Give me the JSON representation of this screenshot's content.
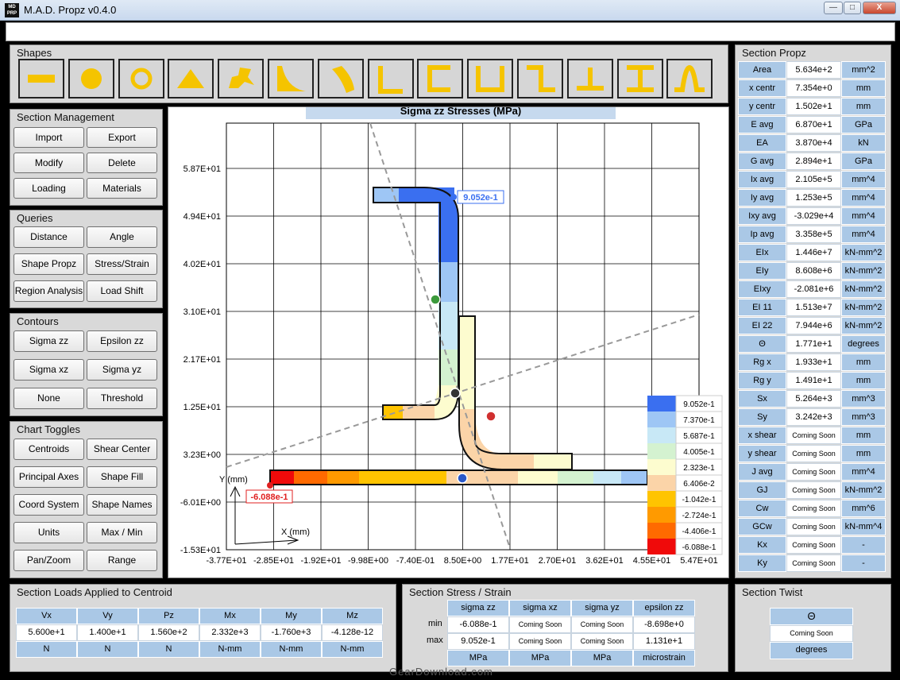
{
  "window": {
    "title": "M.A.D. Propz v0.4.0",
    "icon_text": "MD PRP",
    "minimize": "—",
    "maximize": "□",
    "close": "X"
  },
  "shapes": {
    "title": "Shapes",
    "items": [
      "rectangle-shape",
      "circle-shape",
      "ring-shape",
      "triangle-shape",
      "custom-shape",
      "spandrel-shape",
      "curved-shape",
      "angle-shape",
      "channel-shape",
      "u-shape",
      "z-shape",
      "tee-shape",
      "i-beam-shape",
      "hat-shape"
    ]
  },
  "section_management": {
    "title": "Section Management",
    "buttons": [
      "Import",
      "Export",
      "Modify",
      "Delete",
      "Loading",
      "Materials"
    ]
  },
  "queries": {
    "title": "Queries",
    "buttons": [
      "Distance",
      "Angle",
      "Shape Propz",
      "Stress/Strain",
      "Region Analysis",
      "Load Shift"
    ]
  },
  "contours": {
    "title": "Contours",
    "buttons": [
      "Sigma zz",
      "Epsilon zz",
      "Sigma xz",
      "Sigma yz",
      "None",
      "Threshold"
    ]
  },
  "chart_toggles": {
    "title": "Chart Toggles",
    "buttons": [
      "Centroids",
      "Shear Center",
      "Principal Axes",
      "Shape Fill",
      "Coord System",
      "Shape Names",
      "Units",
      "Max / Min",
      "Pan/Zoom",
      "Range"
    ]
  },
  "chart": {
    "title": "Sigma zz Stresses (MPa)",
    "y_ticks": [
      "5.87E+01",
      "4.94E+01",
      "4.02E+01",
      "3.10E+01",
      "2.17E+01",
      "1.25E+01",
      "3.23E+00",
      "-6.01E+00",
      "-1.53E+01"
    ],
    "x_ticks": [
      "-3.77E+01",
      "-2.85E+01",
      "-1.92E+01",
      "-9.98E+00",
      "-7.40E-01",
      "8.50E+00",
      "1.77E+01",
      "2.70E+01",
      "3.62E+01",
      "4.55E+01",
      "5.47E+01"
    ],
    "max_label": "9.052e-1",
    "min_label": "-6.088e-1",
    "axis_y_label": "Y (mm)",
    "axis_x_label": "X (mm)",
    "legend": [
      {
        "value": "9.052e-1",
        "color": "#3a6ff0"
      },
      {
        "value": "7.370e-1",
        "color": "#9ec6f5"
      },
      {
        "value": "5.687e-1",
        "color": "#c8e8f6"
      },
      {
        "value": "4.005e-1",
        "color": "#d4f2d0"
      },
      {
        "value": "2.323e-1",
        "color": "#fdfccf"
      },
      {
        "value": "6.406e-2",
        "color": "#fbd4a8"
      },
      {
        "value": "-1.042e-1",
        "color": "#ffc400"
      },
      {
        "value": "-2.724e-1",
        "color": "#ff9a00"
      },
      {
        "value": "-4.406e-1",
        "color": "#ff6a00"
      },
      {
        "value": "-6.088e-1",
        "color": "#f00a0a"
      }
    ]
  },
  "section_propz": {
    "title": "Section Propz",
    "rows": [
      [
        "Area",
        "5.634e+2",
        "mm^2"
      ],
      [
        "x centr",
        "7.354e+0",
        "mm"
      ],
      [
        "y centr",
        "1.502e+1",
        "mm"
      ],
      [
        "E avg",
        "6.870e+1",
        "GPa"
      ],
      [
        "EA",
        "3.870e+4",
        "kN"
      ],
      [
        "G avg",
        "2.894e+1",
        "GPa"
      ],
      [
        "Ix avg",
        "2.105e+5",
        "mm^4"
      ],
      [
        "Iy avg",
        "1.253e+5",
        "mm^4"
      ],
      [
        "Ixy avg",
        "-3.029e+4",
        "mm^4"
      ],
      [
        "Ip avg",
        "3.358e+5",
        "mm^4"
      ],
      [
        "EIx",
        "1.446e+7",
        "kN-mm^2"
      ],
      [
        "EIy",
        "8.608e+6",
        "kN-mm^2"
      ],
      [
        "EIxy",
        "-2.081e+6",
        "kN-mm^2"
      ],
      [
        "EI 11",
        "1.513e+7",
        "kN-mm^2"
      ],
      [
        "EI 22",
        "7.944e+6",
        "kN-mm^2"
      ],
      [
        "Θ",
        "1.771e+1",
        "degrees"
      ],
      [
        "Rg x",
        "1.933e+1",
        "mm"
      ],
      [
        "Rg y",
        "1.491e+1",
        "mm"
      ],
      [
        "Sx",
        "5.264e+3",
        "mm^3"
      ],
      [
        "Sy",
        "3.242e+3",
        "mm^3"
      ],
      [
        "x shear",
        "Coming Soon",
        "mm"
      ],
      [
        "y shear",
        "Coming Soon",
        "mm"
      ],
      [
        "J avg",
        "Coming Soon",
        "mm^4"
      ],
      [
        "GJ",
        "Coming Soon",
        "kN-mm^2"
      ],
      [
        "Cw",
        "Coming Soon",
        "mm^6"
      ],
      [
        "GCw",
        "Coming Soon",
        "kN-mm^4"
      ],
      [
        "Kx",
        "Coming Soon",
        "-"
      ],
      [
        "Ky",
        "Coming Soon",
        "-"
      ]
    ]
  },
  "loads": {
    "title": "Section Loads Applied to Centroid",
    "headers": [
      "Vx",
      "Vy",
      "Pz",
      "Mx",
      "My",
      "Mz"
    ],
    "values": [
      "5.600e+1",
      "1.400e+1",
      "1.560e+2",
      "2.332e+3",
      "-1.760e+3",
      "-4.128e-12"
    ],
    "units": [
      "N",
      "N",
      "N",
      "N-mm",
      "N-mm",
      "N-mm"
    ]
  },
  "stress": {
    "title": "Section Stress / Strain",
    "headers": [
      "sigma zz",
      "sigma xz",
      "sigma yz",
      "epsilon zz"
    ],
    "row_labels": [
      "min",
      "max"
    ],
    "min": [
      "-6.088e-1",
      "Coming Soon",
      "Coming Soon",
      "-8.698e+0"
    ],
    "max": [
      "9.052e-1",
      "Coming Soon",
      "Coming Soon",
      "1.131e+1"
    ],
    "units": [
      "MPa",
      "MPa",
      "MPa",
      "microstrain"
    ]
  },
  "twist": {
    "title": "Section Twist",
    "header": "Θ",
    "value": "Coming Soon",
    "unit": "degrees"
  },
  "watermark": "GearDownload.com"
}
